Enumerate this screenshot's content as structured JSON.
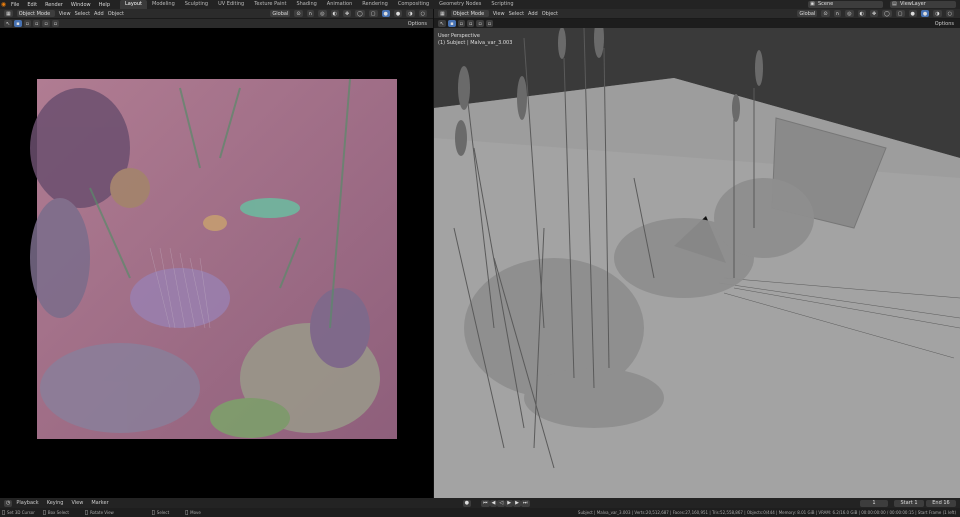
{
  "topbar": {
    "menus": [
      "File",
      "Edit",
      "Render",
      "Window",
      "Help"
    ],
    "workspaces": [
      "Layout",
      "Modeling",
      "Sculpting",
      "UV Editing",
      "Texture Paint",
      "Shading",
      "Animation",
      "Rendering",
      "Compositing",
      "Geometry Nodes",
      "Scripting"
    ],
    "active_workspace": "Layout",
    "scene": "Scene",
    "view_layer": "ViewLayer"
  },
  "left_viewport": {
    "mode": "Object Mode",
    "menus": [
      "View",
      "Select",
      "Add",
      "Object"
    ],
    "transform": "Global",
    "options": "Options"
  },
  "right_viewport": {
    "mode": "Object Mode",
    "menus": [
      "View",
      "Select",
      "Add",
      "Object"
    ],
    "transform": "Global",
    "options": "Options",
    "overlay_title": "User Perspective",
    "overlay_object": "(1) Subject | Malva_var_3.003"
  },
  "timeline": {
    "menus": [
      "Playback",
      "Keying",
      "View",
      "Marker"
    ],
    "frame": "1",
    "start_label": "Start",
    "start": "1",
    "end_label": "End",
    "end": "16"
  },
  "statusbar": {
    "left": [
      "Set 3D Cursor",
      "Box Select",
      "Rotate View",
      "Select",
      "Move"
    ],
    "right": "Subject | Malva_var_3.003 | Verts:20,512,687 | Faces:27,160,951 | Tris:52,558,867 | Objects:0/444 | Memory: 8.01 GiB | VRAM: 6.2/16.0 GiB | 00:00:00:00 / 00:00:00:15 | Start Frame (1 left)"
  },
  "colors": {
    "accent": "#4772b3",
    "viewport_left_bg": "#000000",
    "viewport_right_bg": "#3a3a3a"
  }
}
